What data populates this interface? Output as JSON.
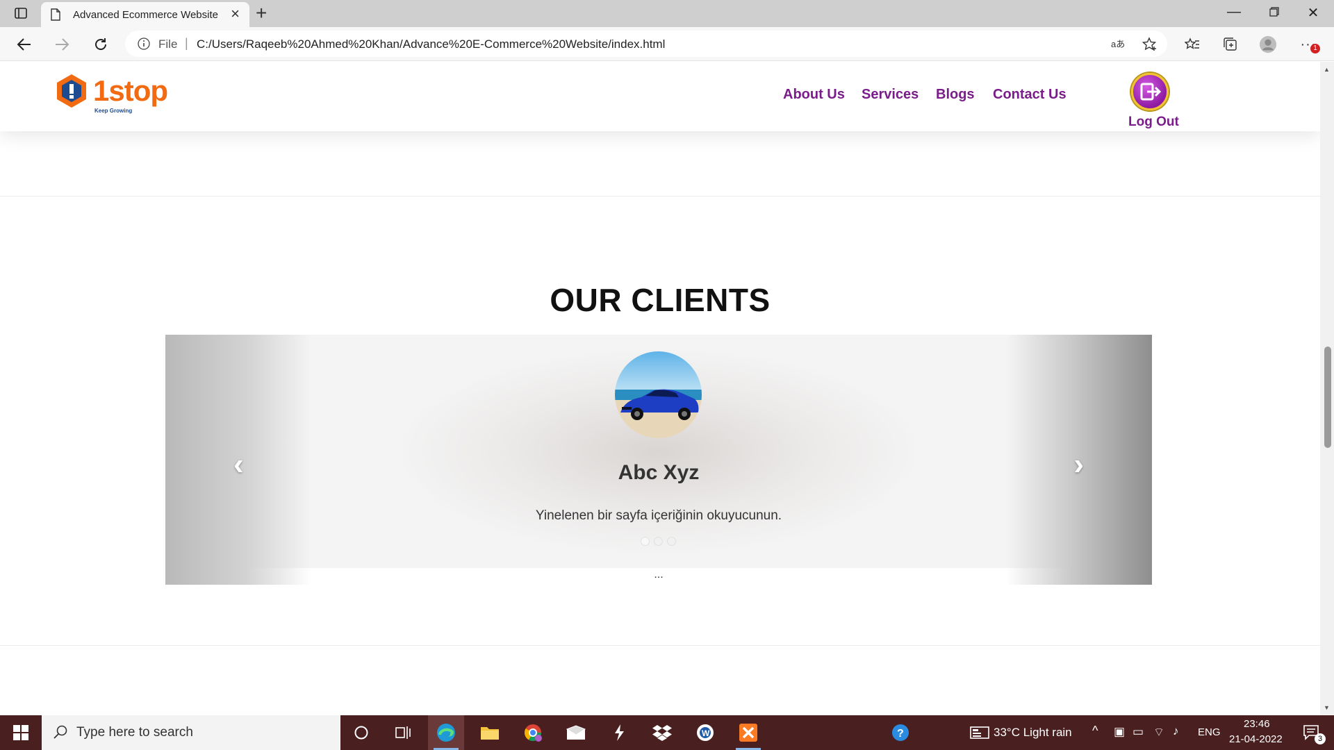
{
  "browser": {
    "tab_title": "Advanced Ecommerce Website",
    "url_scheme": "File",
    "url": "C:/Users/Raqeeb%20Ahmed%20Khan/Advance%20E-Commerce%20Website/index.html",
    "extensions_badge": "1"
  },
  "site": {
    "logo_text": "1stop",
    "logo_tagline": "Keep Growing",
    "nav": [
      "About Us",
      "Services",
      "Blogs",
      "Contact Us"
    ],
    "logout_label": "Log Out",
    "accent_color": "#7a1d8a",
    "logo_color": "#f26a12"
  },
  "clients": {
    "title": "OUR CLIENTS",
    "name": "Abc Xyz",
    "text": "Yinelenen bir sayfa içeriğinin okuyucunun.",
    "more": "...",
    "slide_count": 3,
    "active_slide": 1
  },
  "taskbar": {
    "search_placeholder": "Type here to search",
    "weather": "33°C  Light rain",
    "language": "ENG",
    "time": "23:46",
    "date": "21-04-2022",
    "notifications": "3"
  }
}
